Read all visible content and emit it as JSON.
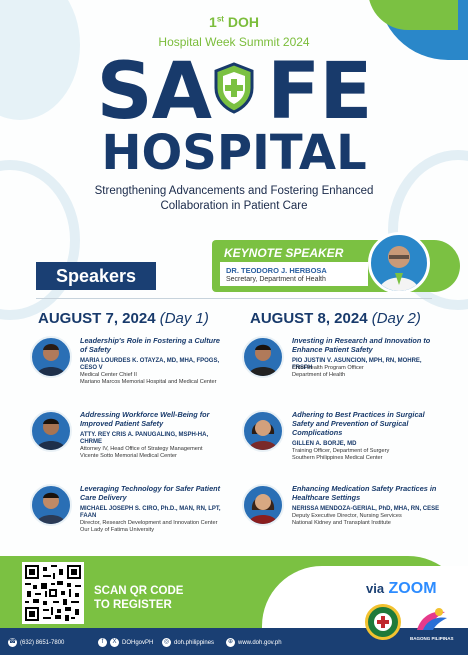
{
  "header": {
    "edition_num": "1",
    "edition_suffix": "st",
    "edition_org": "DOH",
    "summit": "Hospital Week Summit 2024",
    "title_safe_left": "SA",
    "title_safe_right": "FE",
    "title_hospital": "HOSPITAL",
    "tagline_line1": "Strengthening Advancements and Fostering Enhanced",
    "tagline_line2": "Collaboration in Patient Care"
  },
  "speakers_label": "Speakers",
  "keynote": {
    "title": "KEYNOTE SPEAKER",
    "name": "DR. TEODORO J. HERBOSA",
    "role": "Secretary, Department of Health"
  },
  "days": [
    {
      "date": "AUGUST 7, 2024",
      "tag": "(Day 1)",
      "speakers": [
        {
          "topic": "Leadership's Role in Fostering a Culture of Safety",
          "name": "MARIA LOURDES K. OTAYZA, MD, MHA, FPOGS, CESO V",
          "info": "Medical Center Chief II\nMariano Marcos Memorial Hospital and Medical Center"
        },
        {
          "topic": "Addressing Workforce Well-Being for Improved Patient Safety",
          "name": "ATTY. REY CRIS A. PANUGALING, MSPH-HA, CHRME",
          "info": "Attorney IV, Head Office of Strategy Management\nVicente Sotto Memorial Medical Center"
        },
        {
          "topic": "Leveraging Technology for Safer Patient Care Delivery",
          "name": "MICHAEL JOSEPH S. CIRO, Ph.D., MAN, RN, LPT, FAAN",
          "info": "Director, Research Development and Innovation Center\nOur Lady of Fatima University"
        }
      ]
    },
    {
      "date": "AUGUST 8, 2024",
      "tag": "(Day 2)",
      "speakers": [
        {
          "topic": "Investing in Research and Innovation to Enhance Patient Safety",
          "name": "PIO JUSTIN V. ASUNCION, MPH, RN, MOHRE, FRSPH",
          "info": "Chief Health Program Officer\nDepartment of Health"
        },
        {
          "topic": "Adhering to Best Practices in Surgical Safety and Prevention of Surgical Complications",
          "name": "GILLEN A. BORJE, MD",
          "info": "Training Officer, Department of Surgery\nSouthern Philippines Medical Center"
        },
        {
          "topic": "Enhancing Medication Safety Practices in Healthcare Settings",
          "name": "NERISSA MENDOZA-GERIAL, PhD, MHA, RN, CESE",
          "info": "Deputy Executive Director, Nursing Services\nNational Kidney and Transplant Institute"
        }
      ]
    }
  ],
  "footer": {
    "scan_line1": "SCAN QR CODE",
    "scan_line2": "TO REGISTER",
    "via": "via",
    "zoom": "ZOOM",
    "phone": "(632) 8651-7800",
    "twitter": "DOHgovPH",
    "instagram": "doh.philippines",
    "website": "www.doh.gov.ph",
    "bagong_pilipinas": "BAGONG PILIPINAS"
  },
  "colors": {
    "navy": "#183a6b",
    "green": "#7bc142",
    "blue": "#2a87c9"
  }
}
